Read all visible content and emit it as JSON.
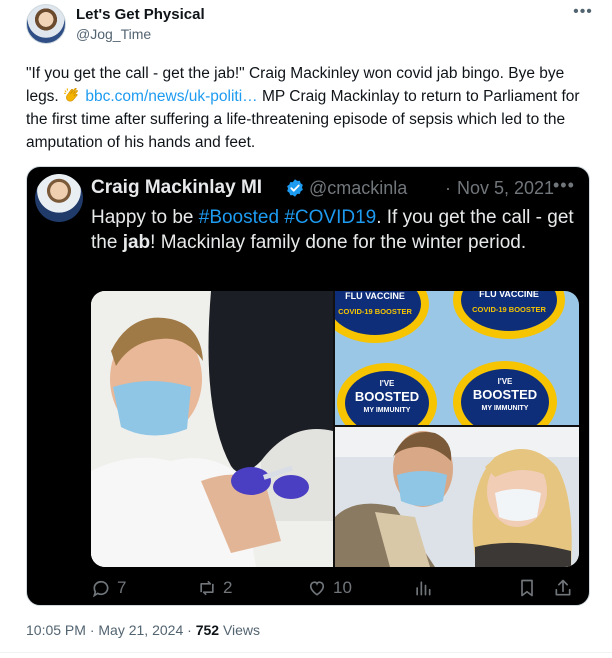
{
  "author": {
    "name": "Let's Get Physical",
    "handle": "@Jog_Time"
  },
  "post": {
    "text_part1": "\"If you get the call - get the jab!\" Craig Mackinley won covid jab bingo. Bye bye legs.",
    "emoji": "clapping-hands",
    "link": "bbc.com/news/uk-politi…",
    "text_part2": "MP Craig Mackinlay to return to Parliament for the first time after suffering a life-threatening episode of sepsis which led to the amputation of his hands and feet."
  },
  "quote": {
    "name": "Craig Mackinlay MI",
    "handle": "@cmackinla",
    "separator": "·",
    "date": "Nov 5, 2021",
    "text_a": "Happy to be",
    "hashtag1": "#Boosted",
    "hashtag2": "#COVID19",
    "text_b": ". If you get the call - get the",
    "bold_word": "jab",
    "text_c": "! Mackinlay family done for the winter period.",
    "stickers": {
      "flu": "FLU VACCINE",
      "covid": "COVID-19 BOOSTER",
      "ive": "I'VE",
      "boosted": "BOOSTED",
      "immunity": "MY IMMUNITY"
    },
    "actions": {
      "replies": "7",
      "reposts": "2",
      "likes": "10"
    }
  },
  "meta": {
    "time": "10:05 PM",
    "sep": "·",
    "date": "May 21, 2024",
    "sep2": "·",
    "views_count": "752",
    "views_label": "Views"
  },
  "colors": {
    "link": "#1d9bf0",
    "verified": "#1d9bf0",
    "quote_bg": "#000000",
    "muted": "#71767b"
  }
}
